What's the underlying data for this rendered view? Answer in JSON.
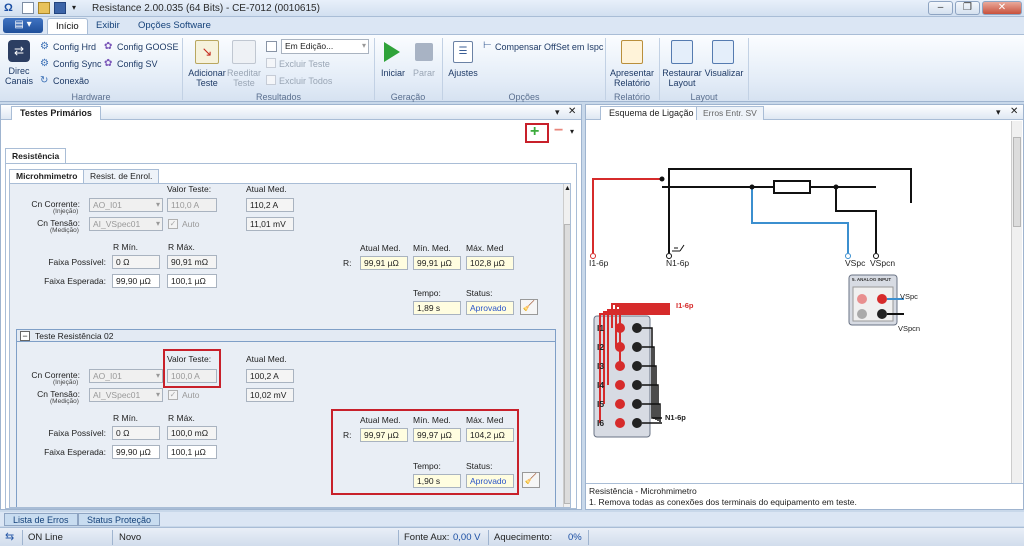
{
  "window": {
    "title": "Resistance 2.00.035 (64 Bits) - CE-7012 (0010615)",
    "controls": [
      "–",
      "❐",
      "✕"
    ]
  },
  "tabs": [
    {
      "label": "Início",
      "active": true
    },
    {
      "label": "Exibir"
    },
    {
      "label": "Opções Software"
    }
  ],
  "ribbon": {
    "hardware": {
      "name": "Hardware",
      "direc_canais": "Direc Canais",
      "config_hrd": "Config Hrd",
      "config_goose": "Config GOOSE",
      "config_sync": "Config Sync",
      "config_sv": "Config SV",
      "conexao": "Conexão"
    },
    "resultados": {
      "name": "Resultados",
      "adicionar_teste": "Adicionar Teste",
      "reeditar_teste": "Reeditar Teste",
      "mode": "Em Edição...",
      "excluir_teste": "Excluir Teste",
      "excluir_todos": "Excluir Todos"
    },
    "geracao": {
      "name": "Geração",
      "iniciar": "Iniciar",
      "parar": "Parar"
    },
    "opcoes": {
      "name": "Opções",
      "ajustes": "Ajustes",
      "compensar": "Compensar OffSet em Ispc"
    },
    "relatorio": {
      "name": "Relatório",
      "apresentar": "Apresentar Relatório"
    },
    "layout": {
      "name": "Layout",
      "restaurar": "Restaurar Layout",
      "visualizar": "Visualizar"
    }
  },
  "left_pane": {
    "title": "Testes Primários",
    "tab": "Resistência",
    "subtabs": [
      "Microhmimetro",
      "Resist. de Enrol."
    ],
    "test1": {
      "valor_teste_label": "Valor Teste:",
      "atual_med_label": "Atual Med.",
      "cn_corrente": "Cn Corrente:",
      "injecao": "(Injeção)",
      "corrente_sel": "AO_I01",
      "valor_teste": "110,0 A",
      "atual_corrente": "110,2 A",
      "cn_tensao": "Cn Tensão:",
      "medicao": "(Medição)",
      "tensao_sel": "AI_VSpec01",
      "auto": "Auto",
      "atual_tensao": "11,01 mV",
      "rmin_label": "R Mín.",
      "rmax_label": "R Máx.",
      "faixa_possivel": "Faixa Possível:",
      "fp_min": "0 Ω",
      "fp_max": "90,91 mΩ",
      "faixa_esperada": "Faixa Esperada:",
      "fe_min": "99,90 µΩ",
      "fe_max": "100,1 µΩ",
      "r_label": "R:",
      "atual_med_h": "Atual Med.",
      "min_med_h": "Mín. Med.",
      "max_med_h": "Máx. Med",
      "atual_med": "99,91 µΩ",
      "min_med": "99,91 µΩ",
      "max_med": "102,8 µΩ",
      "tempo_label": "Tempo:",
      "status_label": "Status:",
      "tempo": "1,89 s",
      "status": "Aprovado"
    },
    "test2": {
      "header": "Teste Resistência 02",
      "valor_teste_label": "Valor Teste:",
      "atual_med_label": "Atual Med.",
      "cn_corrente": "Cn Corrente:",
      "injecao": "(Injeção)",
      "corrente_sel": "AO_I01",
      "valor_teste": "100,0 A",
      "atual_corrente": "100,2 A",
      "cn_tensao": "Cn Tensão:",
      "medicao": "(Medição)",
      "tensao_sel": "AI_VSpec01",
      "auto": "Auto",
      "atual_tensao": "10,02 mV",
      "rmin_label": "R Mín.",
      "rmax_label": "R Máx.",
      "faixa_possivel": "Faixa Possível:",
      "fp_min": "0 Ω",
      "fp_max": "100,0 mΩ",
      "faixa_esperada": "Faixa Esperada:",
      "fe_min": "99,90 µΩ",
      "fe_max": "100,1 µΩ",
      "r_label": "R:",
      "atual_med_h": "Atual Med.",
      "min_med_h": "Mín. Med.",
      "max_med_h": "Máx. Med",
      "atual_med": "99,97 µΩ",
      "min_med": "99,97 µΩ",
      "max_med": "104,2 µΩ",
      "tempo_label": "Tempo:",
      "status_label": "Status:",
      "tempo": "1,90 s",
      "status": "Aprovado"
    }
  },
  "right_pane": {
    "tabs": [
      "Esquema de Ligação",
      "Erros Entr. SV"
    ],
    "diagram": {
      "i1": "I1-6p",
      "n1": "N1-6p",
      "vspc": "VSpc",
      "vspcn": "VSpcn",
      "module": "5. ANALOG INPUT",
      "rows": [
        "I1",
        "I2",
        "I3",
        "I4",
        "I5",
        "I6"
      ]
    },
    "info_title": "Resistência - Microhmimetro",
    "info_text": "1. Remova todas as conexões dos terminais do equipamento em teste."
  },
  "footer_tabs": [
    "Lista de Erros",
    "Status Proteção"
  ],
  "statusbar": {
    "online": "ON Line",
    "novo": "Novo",
    "fonte_aux_label": "Fonte Aux:",
    "fonte_aux": "0,00 V",
    "aquecimento_label": "Aquecimento:",
    "aquecimento": "0%"
  }
}
